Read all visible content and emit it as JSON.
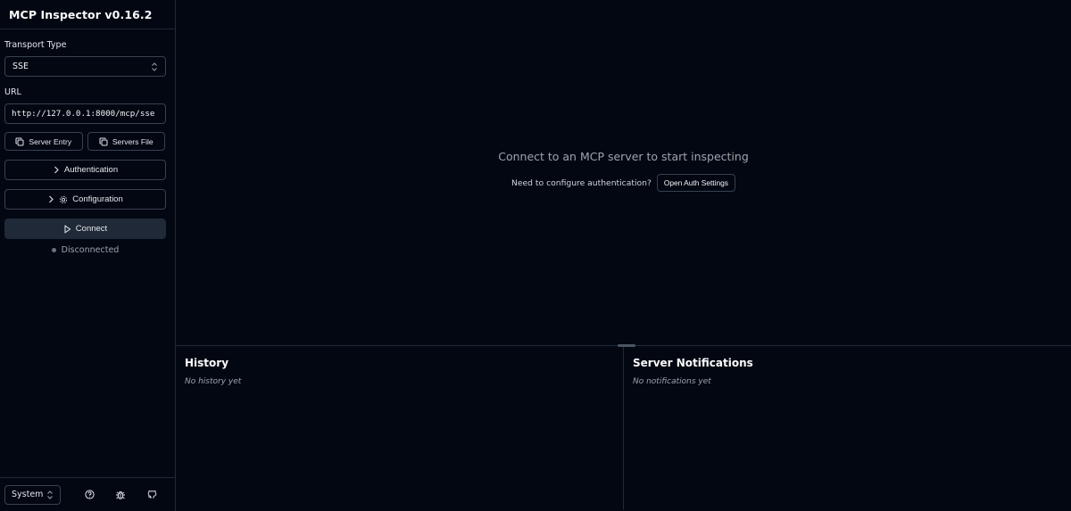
{
  "app": {
    "title": "MCP Inspector v0.16.2"
  },
  "sidebar": {
    "transport_label": "Transport Type",
    "transport_value": "SSE",
    "url_label": "URL",
    "url_value": "http://127.0.0.1:8000/mcp/sse",
    "server_entry_label": "Server Entry",
    "servers_file_label": "Servers File",
    "authentication_label": "Authentication",
    "configuration_label": "Configuration",
    "connect_label": "Connect",
    "status_text": "Disconnected",
    "theme_value": "System"
  },
  "main": {
    "connect_message": "Connect to an MCP server to start inspecting",
    "auth_question": "Need to configure authentication?",
    "auth_button_label": "Open Auth Settings",
    "history_title": "History",
    "history_empty": "No history yet",
    "notifications_title": "Server Notifications",
    "notifications_empty": "No notifications yet"
  },
  "icons": {
    "select_chevron": "chevrons-up-down-icon",
    "copy": "copy-icon",
    "chevron_right": "chevron-right-icon",
    "settings": "gear-icon",
    "play": "play-icon",
    "help": "help-circle-icon",
    "bug": "bug-icon",
    "github": "github-icon"
  },
  "colors": {
    "background": "#030712",
    "border": "#1f2937",
    "connect_button": "#1f2937",
    "status_dot": "#6b7280"
  }
}
